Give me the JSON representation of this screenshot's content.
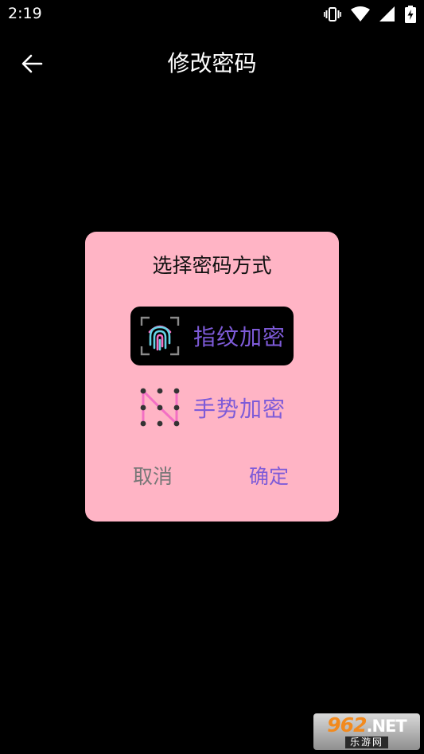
{
  "status_bar": {
    "time": "2:19",
    "icons": [
      "vibrate-icon",
      "wifi-icon",
      "signal-icon",
      "battery-charging-icon"
    ]
  },
  "toolbar": {
    "back_icon": "arrow-left-icon",
    "title": "修改密码"
  },
  "dialog": {
    "title": "选择密码方式",
    "options": [
      {
        "label": "指纹加密",
        "icon": "fingerprint-icon",
        "selected": true
      },
      {
        "label": "手势加密",
        "icon": "gesture-pattern-icon",
        "selected": false
      }
    ],
    "cancel_label": "取消",
    "confirm_label": "确定"
  },
  "colors": {
    "background": "#000000",
    "dialog_background": "#FFB4C5",
    "accent_purple": "#7E5BD8",
    "cancel_gray": "#777777",
    "selected_option_background": "#000000"
  },
  "watermark": {
    "top_number": "962",
    "top_suffix": ".NET",
    "bottom_text": "乐游网"
  }
}
